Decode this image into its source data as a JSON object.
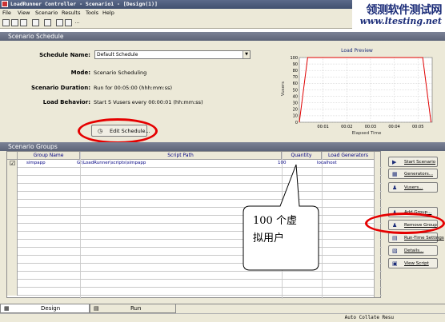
{
  "window": {
    "title": "LoadRunner Controller - Scenario1 - [Design(1)]"
  },
  "watermark": {
    "text": "领测软件测试网",
    "url": "www.ltesting.net"
  },
  "menu": [
    "File",
    "View",
    "Scenario",
    "Results",
    "Tools",
    "Help"
  ],
  "schedule": {
    "header": "Scenario Schedule",
    "name_label": "Schedule Name:",
    "name_value": "Default Schedule",
    "mode_label": "Mode:",
    "mode_value": "Scenario Scheduling",
    "duration_label": "Scenario Duration:",
    "duration_value": "Run for 00:05:00 (hhh:mm:ss)",
    "behavior_label": "Load Behavior:",
    "behavior_value": "Start 5 Vusers every 00:00:01 (hh:mm:ss)",
    "edit_button": "Edit Schedule..."
  },
  "chart_data": {
    "type": "line",
    "title": "Load Preview",
    "xlabel": "Elapsed Time",
    "ylabel": "Vusers",
    "x_ticks": [
      "00:01",
      "00:02",
      "00:03",
      "00:04",
      "00:05"
    ],
    "y_ticks": [
      "0",
      "10",
      "20",
      "30",
      "40",
      "50",
      "60",
      "70",
      "80",
      "90",
      "100"
    ],
    "ylim": [
      0,
      100
    ],
    "xlim_minutes": [
      0,
      5.6
    ],
    "series": [
      {
        "color": "#e00000",
        "x_minutes": [
          0,
          0.35,
          5.2,
          5.55
        ],
        "y": [
          0,
          100,
          100,
          0
        ]
      }
    ],
    "grid": true
  },
  "groups": {
    "header": "Scenario Groups",
    "columns": [
      "Group Name",
      "Script Path",
      "Quantity",
      "Load Generators"
    ],
    "rows": [
      {
        "checked": true,
        "name": "simpapp",
        "path": "G:\\LoadRunner\\scripts\\simpapp",
        "quantity": "100",
        "generator": "localhost"
      }
    ]
  },
  "side_buttons": [
    {
      "label": "Start Scenario",
      "icon": "play-icon"
    },
    {
      "label": "Generators...",
      "icon": "generators-icon"
    },
    {
      "label": "Vusers...",
      "icon": "vusers-icon"
    },
    {
      "label": "Add Group...",
      "icon": "add-group-icon"
    },
    {
      "label": "Remove Group",
      "icon": "remove-group-icon"
    },
    {
      "label": "Run-Time Settings",
      "icon": "runtime-settings-icon"
    },
    {
      "label": "Details...",
      "icon": "details-icon"
    },
    {
      "label": "View Script",
      "icon": "view-script-icon"
    }
  ],
  "callout": {
    "line1": "100 个虚",
    "line2": "拟用户"
  },
  "tabs": {
    "design": "Design",
    "run": "Run"
  },
  "status": {
    "auto_collate": "Auto Collate Resu"
  },
  "colors": {
    "highlight_ring": "#e50000",
    "panel_header": "#6a7185",
    "link_text": "#000082"
  }
}
